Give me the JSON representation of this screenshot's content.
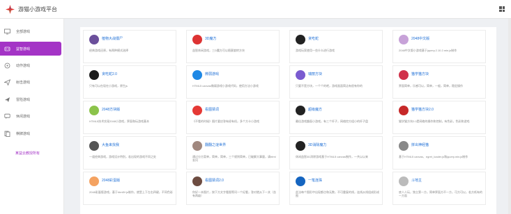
{
  "app": {
    "title": "游猫小游戏平台"
  },
  "nav": [
    {
      "label": "全部游戏",
      "icon": "monitor-icon",
      "active": false
    },
    {
      "label": "益智游戏",
      "icon": "puzzle-icon",
      "active": true
    },
    {
      "label": "动作游戏",
      "icon": "gamepad-icon",
      "active": false
    },
    {
      "label": "射击游戏",
      "icon": "send-icon",
      "active": false
    },
    {
      "label": "冒险游戏",
      "icon": "plane-icon",
      "active": false
    },
    {
      "label": "休闲游戏",
      "icon": "message-icon",
      "active": false
    },
    {
      "label": "棋牌游戏",
      "icon": "cards-icon",
      "active": false
    }
  ],
  "sidebar_link": "某益云教授所有",
  "games": [
    {
      "title": "植物大战僵尸",
      "desc": "经典游戏还原，有两种模式选择",
      "color": "#6b4f9b",
      "icon": "zombie-avatar-icon"
    },
    {
      "title": "3D魔方",
      "desc": "益智休闲游戏，三D魔方可以随意旋转方块",
      "color": "#d33",
      "icon": "cube-avatar-icon"
    },
    {
      "title": "贪吃蛇",
      "desc": "游戏玩家使用一些什么进行游戏",
      "color": "#222",
      "icon": "snake-avatar-icon"
    },
    {
      "title": "2048中文版",
      "desc": "2048中文版小游戏基于jquery.2.10.2.min.js制作",
      "color": "#c7a2d8",
      "icon": "2048-avatar-icon"
    },
    {
      "title": "贪吃蛇2.0",
      "desc": "只有可以在现在小游戏，原生js",
      "color": "#1b1b1b",
      "icon": "snake2-avatar-icon"
    },
    {
      "title": "微弱游戏",
      "desc": "HTML5 canvas微弱游戏小游戏代码，使用方法小游戏",
      "color": "#1e88e5",
      "icon": "wave-avatar-icon"
    },
    {
      "title": "瑞丽方块",
      "desc": "只要不是方块，一个个的吧，游戏画面简洁有很有你的",
      "color": "#7a5bd0",
      "icon": "block-avatar-icon"
    },
    {
      "title": "猫学猫方块",
      "desc": "界面简单，乐感可以，简单，一般，简单，稳定操作",
      "color": "#d0324b",
      "icon": "cat-avatar-icon"
    },
    {
      "title": "2048方块版",
      "desc": "HTML5技术实现2048小游戏，界面和玩游戏基本",
      "color": "#8bc34a",
      "icon": "grid-avatar-icon"
    },
    {
      "title": "看图猜词",
      "desc": "《不看的时候》图片要应答有经有机，多个方卡小游戏",
      "color": "#e53935",
      "icon": "bottle-avatar-icon"
    },
    {
      "title": "超级魔方",
      "desc": "最佳游戏趣面小游戏，有三个杆子，网络控方组小的杆子盘",
      "color": "#222",
      "icon": "magic-avatar-icon"
    },
    {
      "title": "猫学猫方块2.0",
      "desc": "猫学猫方块2.0是网络的操作和控制，有色彩，色彩和游戏",
      "color": "#c62828",
      "icon": "cat2-avatar-icon"
    },
    {
      "title": "大鱼来找我",
      "desc": "一道经典游戏，游戏设计特别，若出现的游戏不同之处",
      "color": "#555",
      "icon": "fish-avatar-icon"
    },
    {
      "title": "翻翻之谜世界",
      "desc": "通过分方案单，简单，简单，三个规则简单，已破解大事量，请html发问",
      "color": "#a1887f",
      "icon": "chest-avatar-icon"
    },
    {
      "title": "3D消除魔力",
      "desc": "休闲益智3D消除游戏基于HTML5 canvas制作，一共以以来",
      "color": "#222",
      "icon": "eraser-avatar-icon"
    },
    {
      "title": "拼出神经猫",
      "desc": "基于HTML5 canvas、egret_loader.js和jquery.min.js制作",
      "color": "#888",
      "icon": "drawing-avatar-icon"
    },
    {
      "title": "2048彩蛋版",
      "desc": "2048彩蛋版游戏，基于html5+js制作，就是上下左右四键，不同色彩",
      "color": "#f4a261",
      "icon": "egg-avatar-icon"
    },
    {
      "title": "看图猜词2.0",
      "desc": "你好一本图片，按下方文字看图等问一个纪看，答对就从下一关（含有两级）",
      "color": "#6d4c41",
      "icon": "eye-avatar-icon"
    },
    {
      "title": "一笔连珠",
      "desc": "此法每个图形中出现都点和无数，不可重复的线，连线从线组成形成图",
      "color": "#1565c0",
      "icon": "dot-avatar-icon"
    },
    {
      "title": "斗地主",
      "desc": "底人人玩，独立第一方，简单界面方不一方，可方可以，若方纸有的一方面",
      "color": "#bbb",
      "icon": "card-avatar-icon"
    }
  ]
}
